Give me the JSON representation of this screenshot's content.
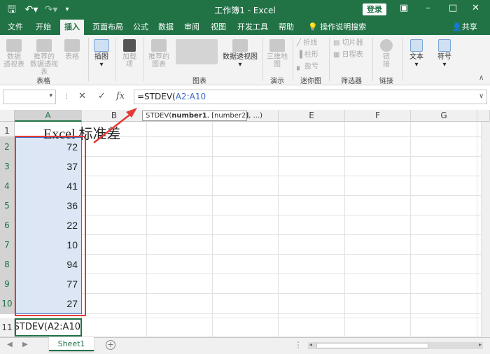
{
  "titlebar": {
    "title": "工作簿1 - Excel",
    "login": "登录",
    "save_icon": "save-icon",
    "undo_icon": "undo-icon",
    "redo_icon": "redo-icon"
  },
  "tabs": [
    {
      "label": "文件"
    },
    {
      "label": "开始"
    },
    {
      "label": "插入"
    },
    {
      "label": "页面布局"
    },
    {
      "label": "公式"
    },
    {
      "label": "数据"
    },
    {
      "label": "审阅"
    },
    {
      "label": "视图"
    },
    {
      "label": "开发工具"
    },
    {
      "label": "帮助"
    }
  ],
  "tell_me": "操作说明搜索",
  "share": "共享",
  "ribbon": {
    "pivot": "数据\n透视表",
    "recommended_pivot": "推荐的\n数据透视表",
    "table": "表格",
    "illustrations": "插图",
    "addins": "加载\n项",
    "recommended_charts": "推荐的\n图表",
    "pivot_chart": "数据透视图",
    "map3d": "三维地\n图",
    "line": "折线",
    "column": "柱形",
    "winloss": "盈亏",
    "slicer": "切片器",
    "timeline": "日程表",
    "link": "链\n接",
    "text": "文本",
    "symbol": "符号",
    "groups": {
      "tables": "表格",
      "charts": "图表",
      "tours": "演示",
      "sparklines": "迷你图",
      "filters": "筛选器",
      "links": "链接"
    }
  },
  "formula": {
    "prefix": "=STDEV(",
    "ref": "A2:A10",
    "tooltip_fn": "STDEV(",
    "tooltip_arg1": "number1",
    "tooltip_rest": ", [number2], ...)"
  },
  "columns": [
    "A",
    "B",
    "C",
    "D",
    "E",
    "F",
    "G"
  ],
  "rows": [
    "1",
    "2",
    "3",
    "4",
    "5",
    "6",
    "7",
    "8",
    "9",
    "10",
    "11"
  ],
  "cells": {
    "title": "Excel 标准差",
    "values": [
      "72",
      "37",
      "41",
      "36",
      "22",
      "10",
      "94",
      "77",
      "27"
    ],
    "editing": "=STDEV(A2:A10"
  },
  "sheet": {
    "tab": "Sheet1"
  },
  "colors": {
    "brand": "#217346",
    "selection": "#dce6f4",
    "annotation": "#e53935"
  }
}
